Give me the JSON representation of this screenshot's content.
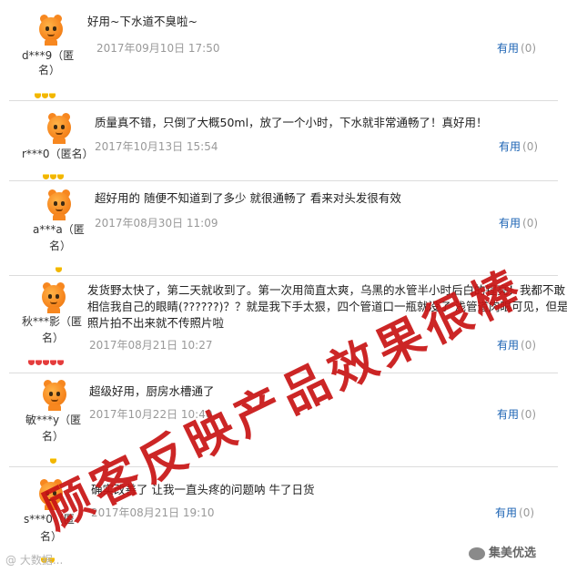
{
  "reviews": [
    {
      "user": "d***9（匿",
      "user2": "名）",
      "content": [
        "好用~下水道不臭啦~"
      ],
      "date": "2017年09月10日  17:50",
      "useful_label": "有用",
      "useful_count": "(0)",
      "gems": 3,
      "gem_color": "#f2b600"
    },
    {
      "user": "r***0（匿名）",
      "user2": "",
      "content": [
        "质量真不错，只倒了大概50ml，放了一个小时，下水就非常通畅了！真好用！"
      ],
      "date": "2017年10月13日  15:54",
      "useful_label": "有用",
      "useful_count": "(0)",
      "gems": 3,
      "gem_color": "#f2b600"
    },
    {
      "user": "a***a（匿",
      "user2": "名）",
      "content": [
        "超好用的 随便不知道到了多少 就很通畅了 看来对头发很有效"
      ],
      "date": "2017年08月30日  11:09",
      "useful_label": "有用",
      "useful_count": "(0)",
      "gems": 1,
      "gem_color": "#f2b600"
    },
    {
      "user": "秋***影（匿",
      "user2": "名）",
      "content": [
        "发货野太快了，第二天就收到了。第一次用简直太爽，乌黑的水管半小时后白的锃亮！我都不敢",
        "相信我自己的眼睛(??????)？？就是我下手太狠，四个管道口一瓶就没了 浅管道肉眼可见，但是",
        "照片拍不出来就不传照片啦"
      ],
      "date": "2017年08月21日  10:27",
      "useful_label": "有用",
      "useful_count": "(0)",
      "gems": 5,
      "gem_color": "#e43c3c"
    },
    {
      "user": "敏***y（匿",
      "user2": "名）",
      "content": [
        "超级好用，厨房水槽通了"
      ],
      "date": "2017年10月22日  10:40",
      "useful_label": "有用",
      "useful_count": "(0)",
      "gems": 1,
      "gem_color": "#f2b600"
    },
    {
      "user": "s***0（匿",
      "user2": "名）",
      "content": [
        "确实改善了 让我一直头疼的问题呐 牛了日货"
      ],
      "date": "2017年08月21日  19:10",
      "useful_label": "有用",
      "useful_count": "(0)",
      "gems": 2,
      "gem_color": "#f2b600"
    }
  ],
  "overlay": {
    "stamp_text": "顾客反映产品效果很棒",
    "stamp_color": "#c81414",
    "watermark_left": "@ 大数据...",
    "watermark_right": "集美优选"
  }
}
